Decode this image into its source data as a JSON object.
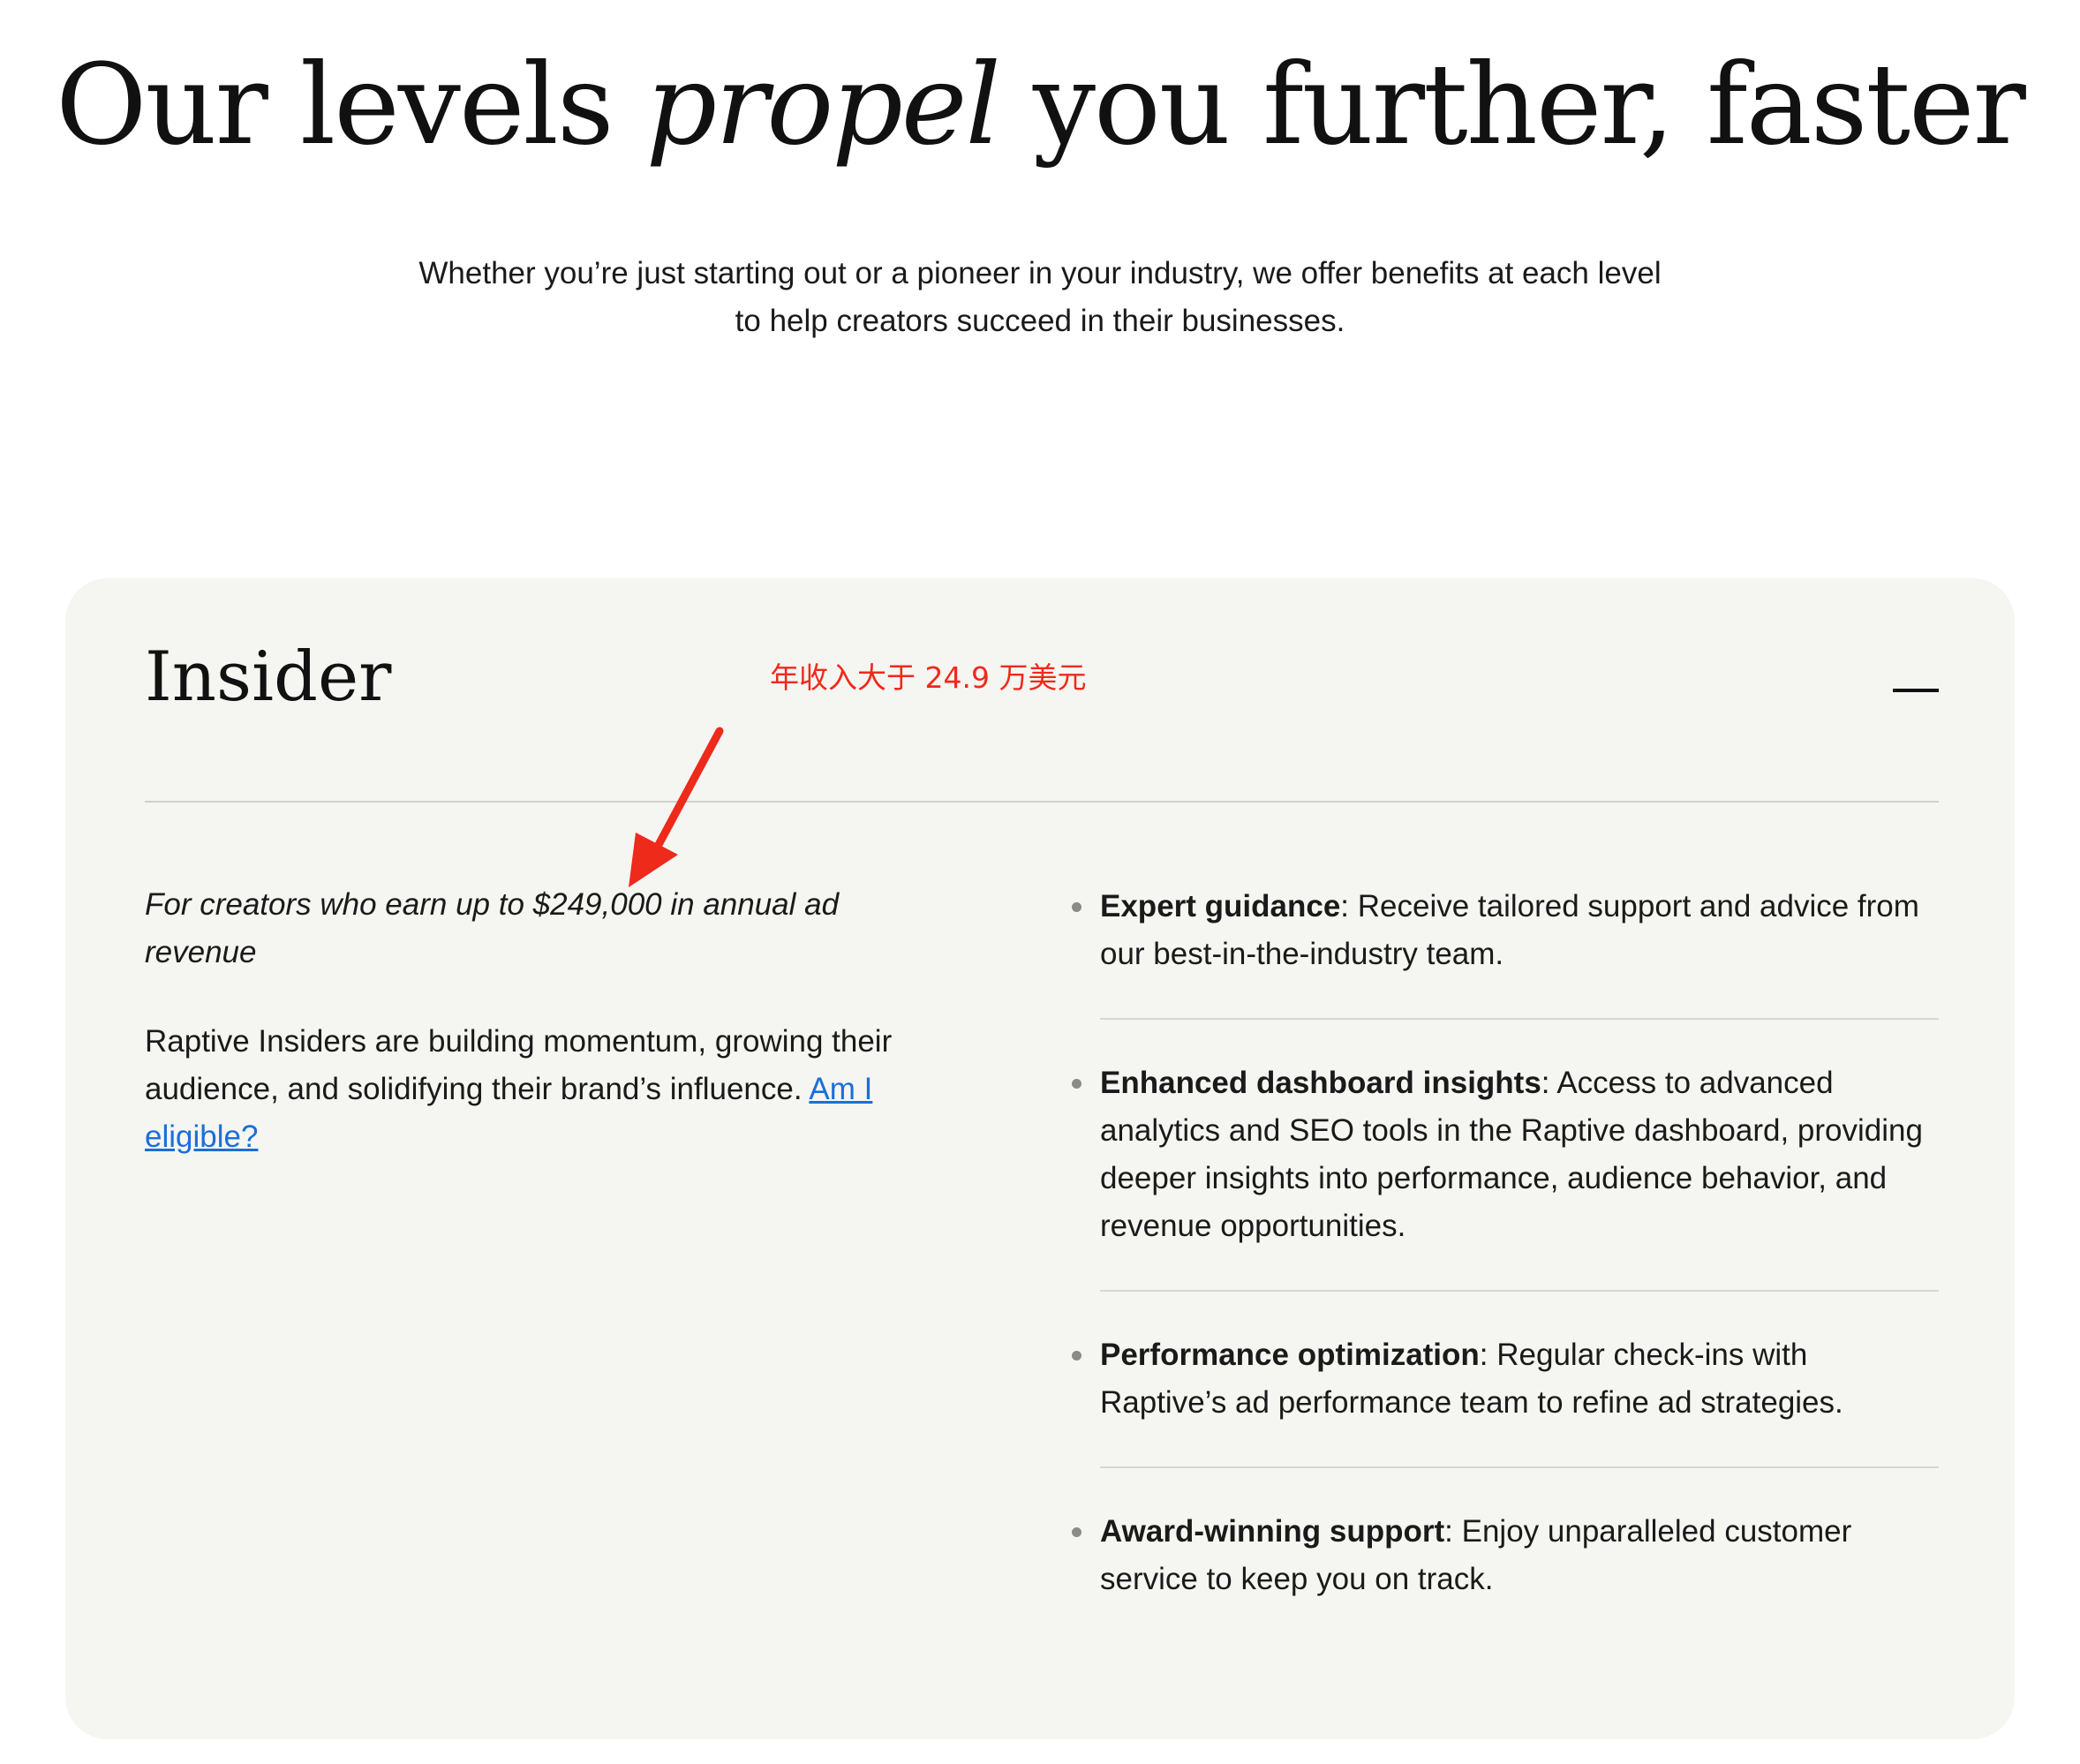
{
  "hero": {
    "title_before": "Our levels ",
    "title_emphasis": "propel",
    "title_after": " you further, faster",
    "subtitle_line1": "Whether you’re just starting out or a pioneer in your industry, we offer benefits at each level",
    "subtitle_line2": "to help creators succeed in their businesses."
  },
  "tier": {
    "name": "Insider",
    "toggle_icon": "minus-icon",
    "qualifier": "For creators who earn up to $249,000 in annual ad revenue",
    "description": "Raptive Insiders are building momentum, growing their audience, and solidifying their brand’s influence.",
    "link_label": "Am I eligible?",
    "benefits": [
      {
        "title": "Expert guidance",
        "text": ": Receive tailored support and advice from our best-in-the-industry team."
      },
      {
        "title": "Enhanced dashboard insights",
        "text": ": Access to advanced analytics and SEO tools in the Raptive dashboard, providing deeper insights into performance, audience behavior, and revenue opportunities."
      },
      {
        "title": "Performance optimization",
        "text": ": Regular check-ins with Raptive’s ad performance team to refine ad strategies."
      },
      {
        "title": "Award-winning support",
        "text": ": Enjoy unparalleled customer service to keep you on track."
      }
    ]
  },
  "annotation": {
    "text": "年收入大于 24.9 万美元",
    "color": "#ee2a1b",
    "icon": "red-arrow-icon"
  },
  "colors": {
    "card_background": "#f5f5f2",
    "link": "#1a6fd8",
    "bullet": "#8a8a8a"
  }
}
